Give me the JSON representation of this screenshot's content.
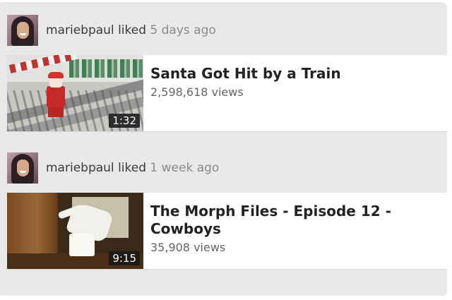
{
  "activities": [
    {
      "actor": {
        "name": "mariebpaul",
        "action": "liked",
        "time": "5 days ago"
      },
      "video": {
        "title": "Santa Got Hit by a Train",
        "views": "2,598,618 views",
        "duration": "1:32"
      }
    },
    {
      "actor": {
        "name": "mariebpaul",
        "action": "liked",
        "time": "1 week ago"
      },
      "video": {
        "title": "The Morph Files - Episode 12 - Cowboys",
        "views": "35,908 views",
        "duration": "9:15"
      }
    }
  ],
  "colors": {
    "feed_background": "#e9e9e9",
    "card_background": "#ffffff",
    "title_text": "#222222",
    "meta_text": "#8a8a8a"
  }
}
